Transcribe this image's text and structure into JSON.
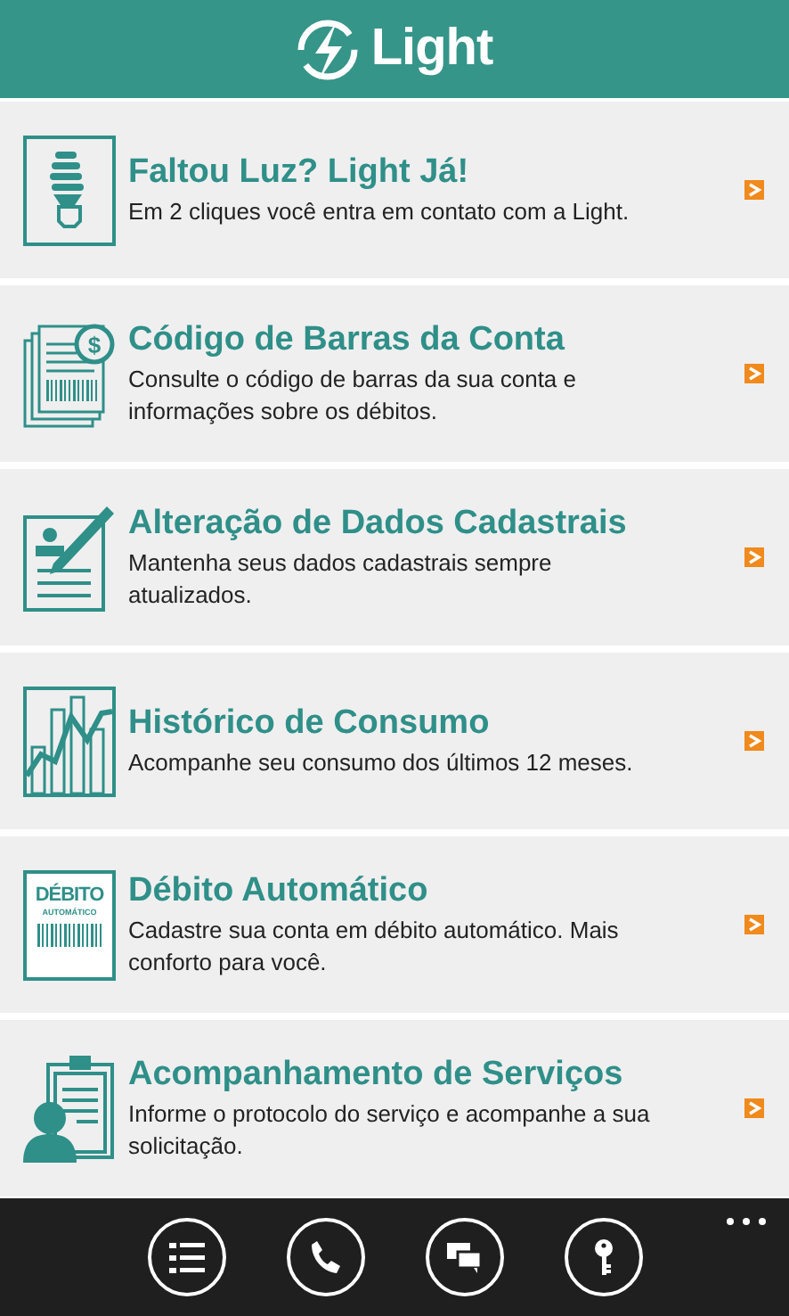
{
  "header": {
    "logo_text": "Light"
  },
  "items": [
    {
      "kind": "bulb",
      "title": "Faltou Luz? Light Já!",
      "description": "Em 2 cliques você entra em contato com a Light."
    },
    {
      "kind": "bill",
      "icon_symbol": "$",
      "title": "Código de Barras da Conta",
      "description": "Consulte o código de barras da sua conta e informações sobre os débitos."
    },
    {
      "kind": "form",
      "title": "Alteração de Dados Cadastrais",
      "description": "Mantenha seus dados cadastrais sempre atualizados."
    },
    {
      "kind": "chart",
      "title": "Histórico de Consumo",
      "description": "Acompanhe seu consumo dos últimos 12 meses."
    },
    {
      "kind": "debit",
      "title": "Débito Automático",
      "description": "Cadastre sua conta em débito automático. Mais conforto para você.",
      "icon_lines": [
        "DÉBITO",
        "AUTOMÁTICO"
      ]
    },
    {
      "kind": "clipboard",
      "title": "Acompanhamento de Serviços",
      "description": "Informe o protocolo do serviço e acompanhe a sua solicitação."
    }
  ],
  "app_bar": {
    "buttons": [
      {
        "kind": "list"
      },
      {
        "kind": "phone"
      },
      {
        "kind": "chat"
      },
      {
        "kind": "key"
      }
    ]
  }
}
